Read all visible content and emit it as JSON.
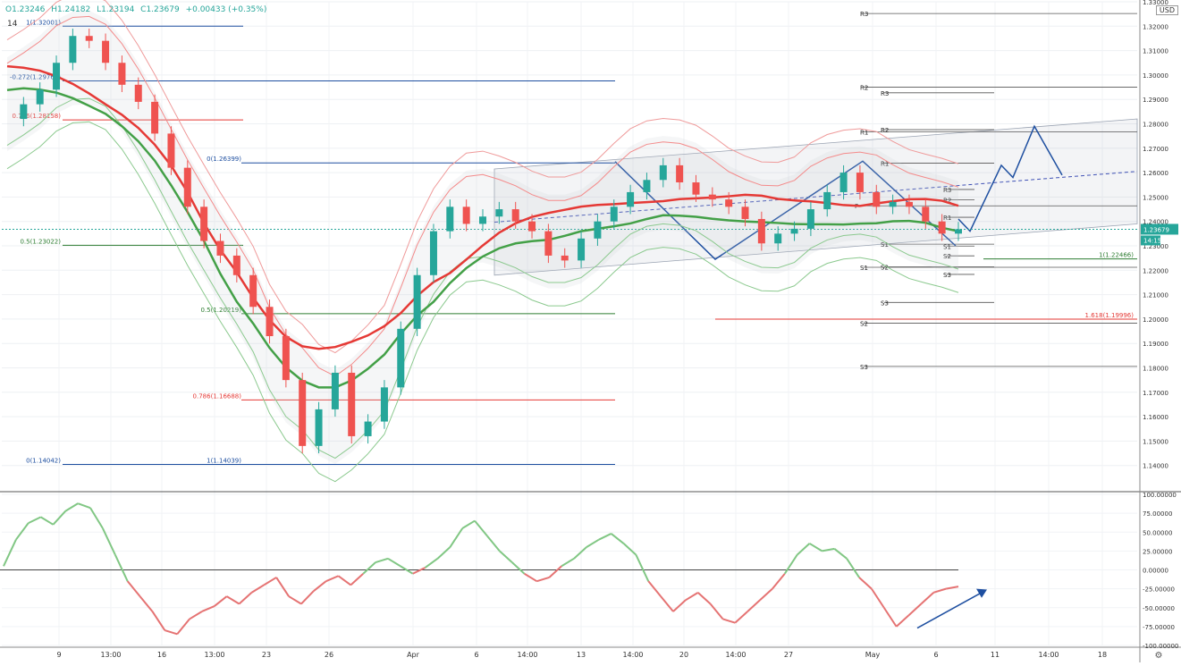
{
  "header": {
    "ohlc_open": "O1.23246",
    "ohlc_high": "H1.24182",
    "ohlc_low": "L1.23194",
    "ohlc_close": "C1.23679",
    "ohlc_change": "+0.00433 (+0.35%)",
    "period": "14",
    "currency": "USD"
  },
  "price_badges": {
    "last": "1.23679",
    "countdown": "14:15"
  },
  "chart_data": [
    {
      "type": "line",
      "panel": "price",
      "ylim": [
        1.13,
        1.33
      ],
      "y_ticks": [
        "1.33000",
        "1.32000",
        "1.31000",
        "1.30000",
        "1.29000",
        "1.28000",
        "1.27000",
        "1.26000",
        "1.25000",
        "1.24000",
        "1.23000",
        "1.22000",
        "1.21000",
        "1.20000",
        "1.19000",
        "1.18000",
        "1.17000",
        "1.16000",
        "1.15000",
        "1.14000"
      ],
      "x_ticks": [
        "9",
        "13:00",
        "16",
        "13:00",
        "23",
        "26",
        "Apr",
        "6",
        "14:00",
        "13",
        "14:00",
        "20",
        "14:00",
        "27",
        "May",
        "6",
        "11",
        "14:00",
        "18"
      ],
      "candle_closes": [
        1.282,
        1.288,
        1.294,
        1.305,
        1.316,
        1.314,
        1.305,
        1.296,
        1.289,
        1.276,
        1.262,
        1.246,
        1.232,
        1.226,
        1.218,
        1.205,
        1.193,
        1.175,
        1.148,
        1.163,
        1.178,
        1.152,
        1.158,
        1.172,
        1.196,
        1.218,
        1.236,
        1.246,
        1.239,
        1.242,
        1.245,
        1.24,
        1.236,
        1.226,
        1.224,
        1.233,
        1.24,
        1.246,
        1.252,
        1.257,
        1.263,
        1.256,
        1.251,
        1.249,
        1.246,
        1.241,
        1.231,
        1.235,
        1.237,
        1.245,
        1.252,
        1.26,
        1.252,
        1.246,
        1.248,
        1.246,
        1.24,
        1.235,
        1.2368
      ],
      "fib_levels": [
        {
          "label": "1(1.32001)",
          "value": 1.32001
        },
        {
          "label": "-0.272(1.29760)",
          "value": 1.2976
        },
        {
          "label": "0.786(1.28158)",
          "value": 1.28158
        },
        {
          "label": "0(1.26399)",
          "value": 1.26399
        },
        {
          "label": "0.5(1.23022)",
          "value": 1.23022
        },
        {
          "label": "0.5(1.20219)",
          "value": 1.20219
        },
        {
          "label": "0.786(1.16688)",
          "value": 1.16688
        },
        {
          "label": "0(1.14042)",
          "value": 1.14042
        },
        {
          "label": "1(1.14039)",
          "value": 1.14039
        },
        {
          "label": "1(1.22466)",
          "value": 1.22466
        },
        {
          "label": "1.618(1.19996)",
          "value": 1.19996
        }
      ],
      "pivot_levels": [
        {
          "label": "R3",
          "value": 1.3252
        },
        {
          "label": "R2",
          "value": 1.295
        },
        {
          "label": "R1",
          "value": 1.2767
        },
        {
          "label": "S1",
          "value": 1.2212
        },
        {
          "label": "S2",
          "value": 1.1983
        },
        {
          "label": "S3",
          "value": 1.1806
        },
        {
          "label": "R3",
          "value": 1.2927
        },
        {
          "label": "R2",
          "value": 1.2776
        },
        {
          "label": "R1",
          "value": 1.2639
        },
        {
          "label": "S1",
          "value": 1.2307
        },
        {
          "label": "S2",
          "value": 1.2214
        },
        {
          "label": "S3",
          "value": 1.2068
        },
        {
          "label": "R3",
          "value": 1.2531
        },
        {
          "label": "R2",
          "value": 1.2489
        },
        {
          "label": "R1",
          "value": 1.2417
        },
        {
          "label": "S1",
          "value": 1.2299
        },
        {
          "label": "S2",
          "value": 1.2259
        },
        {
          "label": "S3",
          "value": 1.2183
        },
        {
          "label": "P",
          "value": 1.2464
        }
      ]
    },
    {
      "type": "line",
      "panel": "oscillator",
      "ylim": [
        -100,
        100
      ],
      "y_ticks": [
        "100.00000",
        "75.00000",
        "50.00000",
        "25.00000",
        "0.00000",
        "-25.00000",
        "-50.00000",
        "-75.00000",
        "-100.00000"
      ],
      "values": [
        5,
        40,
        62,
        70,
        60,
        78,
        88,
        82,
        55,
        20,
        -15,
        -35,
        -55,
        -80,
        -85,
        -65,
        -55,
        -48,
        -35,
        -45,
        -30,
        -20,
        -10,
        -35,
        -45,
        -28,
        -15,
        -8,
        -20,
        -5,
        10,
        15,
        5,
        -5,
        3,
        15,
        30,
        55,
        65,
        45,
        25,
        10,
        -5,
        -15,
        -10,
        5,
        15,
        30,
        40,
        48,
        35,
        20,
        -15,
        -35,
        -55,
        -40,
        -30,
        -45,
        -65,
        -70,
        -55,
        -40,
        -25,
        -5,
        20,
        35,
        25,
        28,
        15,
        -10,
        -25,
        -50,
        -75,
        -60,
        -45,
        -30,
        -25,
        -22
      ],
      "zero_line": 0
    }
  ]
}
